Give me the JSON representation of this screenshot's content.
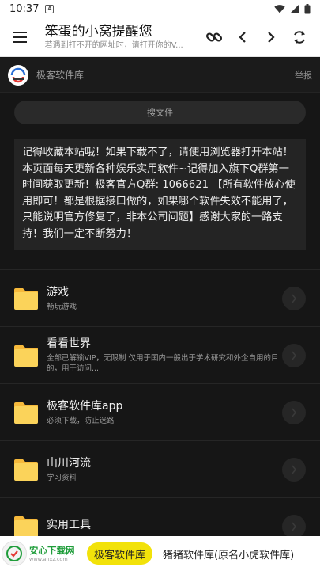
{
  "status_bar": {
    "time": "10:37",
    "notification": "A",
    "icons": [
      "wifi-icon",
      "signal-icon",
      "battery-icon"
    ]
  },
  "app_bar": {
    "title": "笨蛋的小窝提醒您",
    "subtitle": "若遇到打不开的网址时，请打开你的V...",
    "icons": [
      "menu-icon",
      "link-icon",
      "back-icon",
      "forward-icon",
      "refresh-icon"
    ]
  },
  "site": {
    "name": "极客软件库",
    "report": "举报"
  },
  "search": {
    "label": "搜文件"
  },
  "notice": {
    "text": "记得收藏本站哦！如果下载不了，请使用浏览器打开本站！本页面每天更新各种娱乐实用软件~记得加入旗下Q群第一时间获取更新！极客官方Q群: 1066621 【所有软件放心使用即可！都是根据接口做的，如果哪个软件失效不能用了，只能说明官方修复了，非本公司问题】感谢大家的一路支持！我们一定不断努力！"
  },
  "items": [
    {
      "title": "游戏",
      "desc": "畅玩游戏"
    },
    {
      "title": "看看世界",
      "desc": "全部已解锁VIP，无限制 仅用于国内一般出于学术研究和外企自用的目的，用于访问..."
    },
    {
      "title": "极客软件库app",
      "desc": "必须下载，防止迷路"
    },
    {
      "title": "山川河流",
      "desc": "学习资料"
    },
    {
      "title": "实用工具",
      "desc": ""
    }
  ],
  "banner": {
    "brand_name": "安心下载网",
    "brand_url": "www.anxz.com",
    "active_tab": "极客软件库",
    "tabs": [
      "猪猪软件库(原名小虎软件库)"
    ]
  },
  "colors": {
    "background": "#161616",
    "folder": "#fbd35a",
    "folder_tab": "#f6b93b",
    "pill": "#f2e20a",
    "brand_green": "#1f9d3a"
  }
}
